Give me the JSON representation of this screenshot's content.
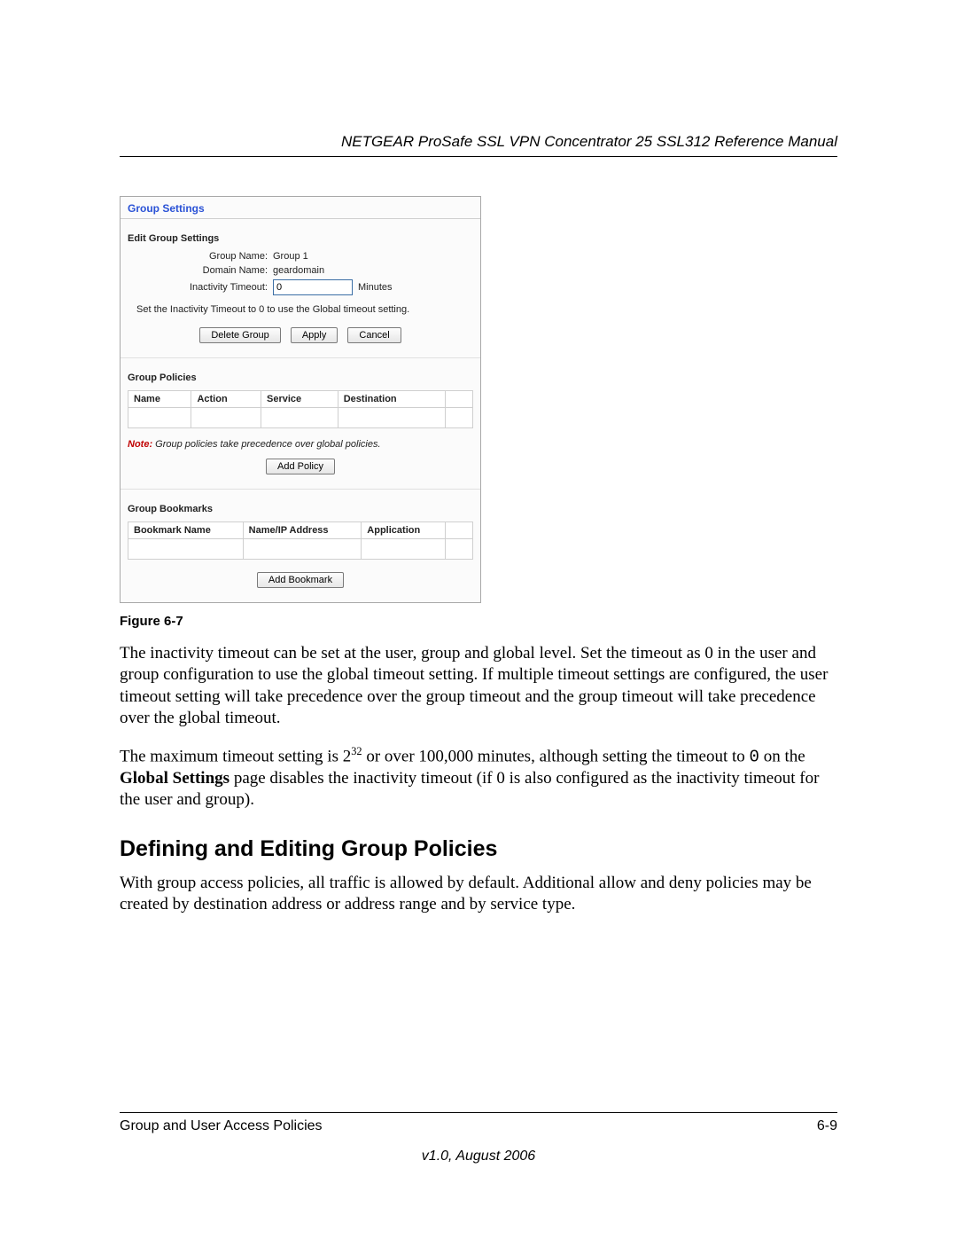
{
  "doc": {
    "header": "NETGEAR ProSafe SSL VPN Concentrator 25 SSL312 Reference Manual"
  },
  "panel": {
    "title": "Group Settings",
    "edit_heading": "Edit Group Settings",
    "group_name_label": "Group Name:",
    "group_name_value": "Group 1",
    "domain_name_label": "Domain Name:",
    "domain_name_value": "geardomain",
    "inactivity_label": "Inactivity Timeout:",
    "inactivity_value": "0",
    "inactivity_suffix": "Minutes",
    "hint": "Set the Inactivity Timeout to 0 to use the Global timeout setting.",
    "btn_delete": "Delete Group",
    "btn_apply": "Apply",
    "btn_cancel": "Cancel",
    "policies_heading": "Group Policies",
    "policies_cols": {
      "name": "Name",
      "action": "Action",
      "service": "Service",
      "destination": "Destination"
    },
    "note_label": "Note:",
    "note_text": "Group policies take precedence over global policies.",
    "btn_add_policy": "Add Policy",
    "bookmarks_heading": "Group Bookmarks",
    "bookmarks_cols": {
      "bname": "Bookmark Name",
      "addr": "Name/IP Address",
      "app": "Application"
    },
    "btn_add_bookmark": "Add Bookmark"
  },
  "caption": "Figure 6-7",
  "para1": "The inactivity timeout can be set at the user, group and global level. Set the timeout as 0 in the user and group configuration to use the global timeout setting. If multiple timeout settings are configured, the user timeout setting will take precedence over the group timeout and the group timeout will take precedence over the global timeout.",
  "para2_a": "The maximum timeout setting is 2",
  "para2_sup": "32",
  "para2_b": " or over 100,000 minutes, although setting the timeout to ",
  "para2_zero": "0",
  "para2_c": " on the ",
  "para2_bold": "Global Settings",
  "para2_d": " page disables the inactivity timeout (if 0 is also configured as the inactivity timeout for the user and group).",
  "h2": "Defining and Editing Group Policies",
  "para3": "With group access policies, all traffic is allowed by default. Additional allow and deny policies may be created by destination address or address range and by service type.",
  "footer": {
    "left": "Group and User Access Policies",
    "right": "6-9",
    "version": "v1.0, August 2006"
  }
}
